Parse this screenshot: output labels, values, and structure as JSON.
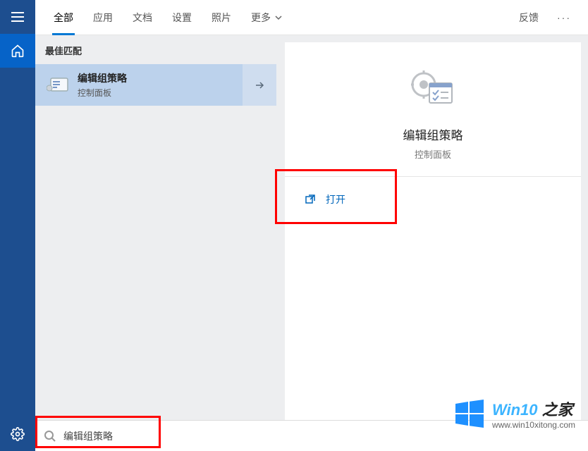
{
  "tabs": {
    "all": "全部",
    "apps": "应用",
    "docs": "文档",
    "settings": "设置",
    "photos": "照片",
    "more": "更多"
  },
  "topbar": {
    "feedback": "反馈"
  },
  "section": {
    "bestMatch": "最佳匹配"
  },
  "result": {
    "title": "编辑组策略",
    "subtitle": "控制面板"
  },
  "preview": {
    "title": "编辑组策略",
    "subtitle": "控制面板"
  },
  "actions": {
    "open": "打开"
  },
  "search": {
    "value": "编辑组策略"
  },
  "watermark": {
    "brand_prefix": "Win10",
    "brand_suffix": "之家",
    "url": "www.win10xitong.com"
  }
}
